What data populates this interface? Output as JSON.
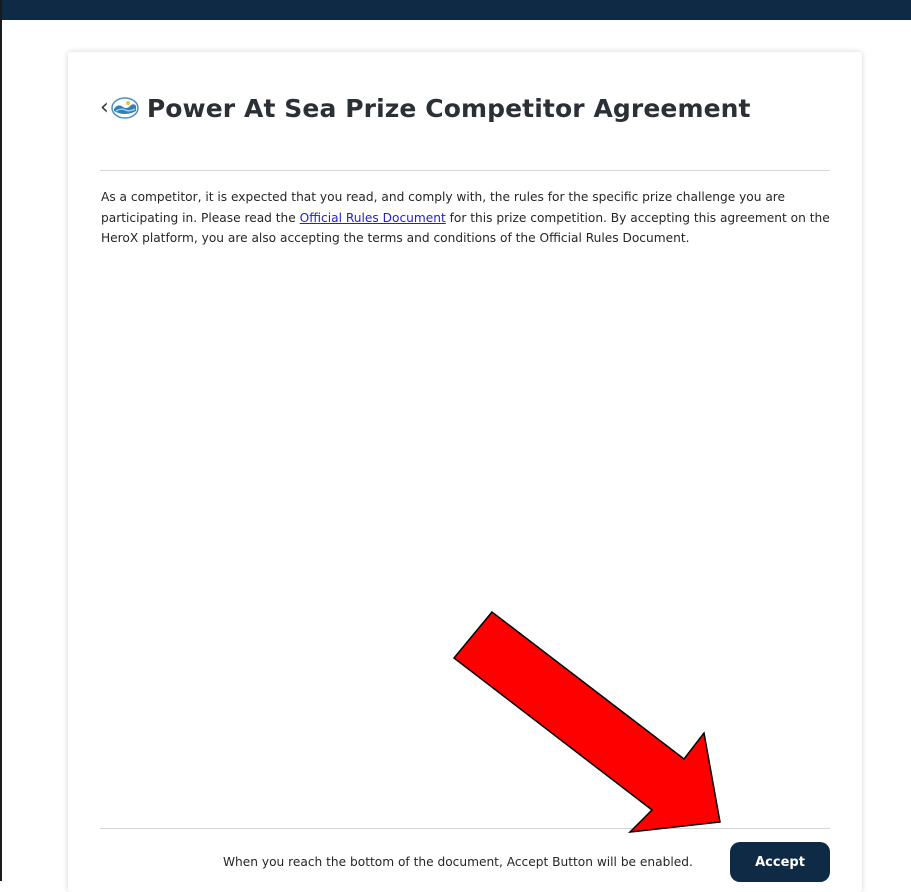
{
  "agreement": {
    "title": "Power At Sea Prize Competitor Agreement",
    "back_chevron": "‹",
    "logo_icon": "ocean-wave-logo",
    "body_part1": "As a competitor, it is expected that you read, and comply with, the rules for the specific prize challenge you are participating in.  Please read the ",
    "link_label": "Official Rules Document",
    "body_part2": " for this prize competition. By accepting this agreement on the HeroX platform, you are also accepting the terms and conditions of the Official Rules Document."
  },
  "footer": {
    "note": "When you reach the bottom of the document, Accept Button will be enabled.",
    "accept_label": "Accept"
  },
  "colors": {
    "brand_navy": "#0e2a44",
    "link": "#2222cc",
    "annotation_arrow": "#ff0000"
  },
  "annotation": {
    "icon": "red-arrow-pointing-to-accept"
  }
}
